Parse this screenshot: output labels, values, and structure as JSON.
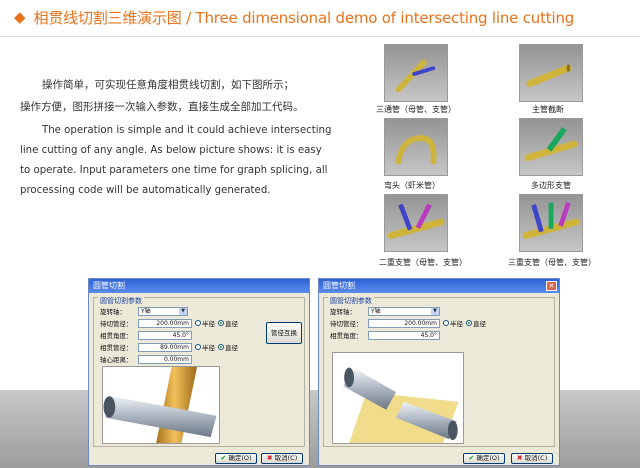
{
  "header": {
    "diamond_icon": "◆",
    "title": "相贯线切割三维演示图 / Three dimensional demo of intersecting line cutting"
  },
  "intro": {
    "cn_line1": "操作简单，可实现任意角度相贯线切割，如下图所示；",
    "cn_line2": "操作方便，图形拼接一次输入参数，直接生成全部加工代码。",
    "en": "The operation is simple and it could achieve intersecting line cutting of any angle. As below picture shows: it is easy to operate. Input parameters one time for graph splicing, all processing code will be automatically generated."
  },
  "thumbnails": [
    {
      "caption": "三通管（母管、支管）"
    },
    {
      "caption": "主管截断"
    },
    {
      "caption": "弯头（虾米管）"
    },
    {
      "caption": "多边形支管"
    },
    {
      "caption": "二重支管（母管、支管）"
    },
    {
      "caption": "三重支管（母管、支管）"
    }
  ],
  "dialog_left": {
    "title": "圆管切割",
    "group_label": "圆管切割参数",
    "rotate_axis_label": "旋转轴：",
    "rotate_axis_value": "Y轴",
    "cut_pipe_label": "待切管径：",
    "cut_pipe_value": "200.00mm",
    "angle_label": "相贯角度：",
    "angle_value": "45.0°",
    "joint_pipe_label": "相贯管径：",
    "joint_pipe_value": "89.00mm",
    "offset_label": "轴心距离：",
    "offset_value": "0.00mm",
    "radius_label": "半径",
    "diameter_label": "直径",
    "swap_button": "管径互换",
    "ok_button": "确定(O)",
    "cancel_button": "取消(C)"
  },
  "dialog_right": {
    "title": "圆管切割",
    "group_label": "圆管切割参数",
    "rotate_axis_label": "旋转轴：",
    "rotate_axis_value": "Y轴",
    "cut_pipe_label": "待切管径：",
    "cut_pipe_value": "200.00mm",
    "angle_label": "相贯角度：",
    "angle_value": "45.0°",
    "radius_label": "半径",
    "diameter_label": "直径",
    "ok_button": "确定(O)",
    "cancel_button": "取消(C)"
  },
  "colors": {
    "accent": "#e8731b",
    "pipe_gold": "#d7b640",
    "branch_blue": "#3f44c8",
    "branch_magenta": "#b83cc0",
    "branch_green": "#1aa85c"
  }
}
